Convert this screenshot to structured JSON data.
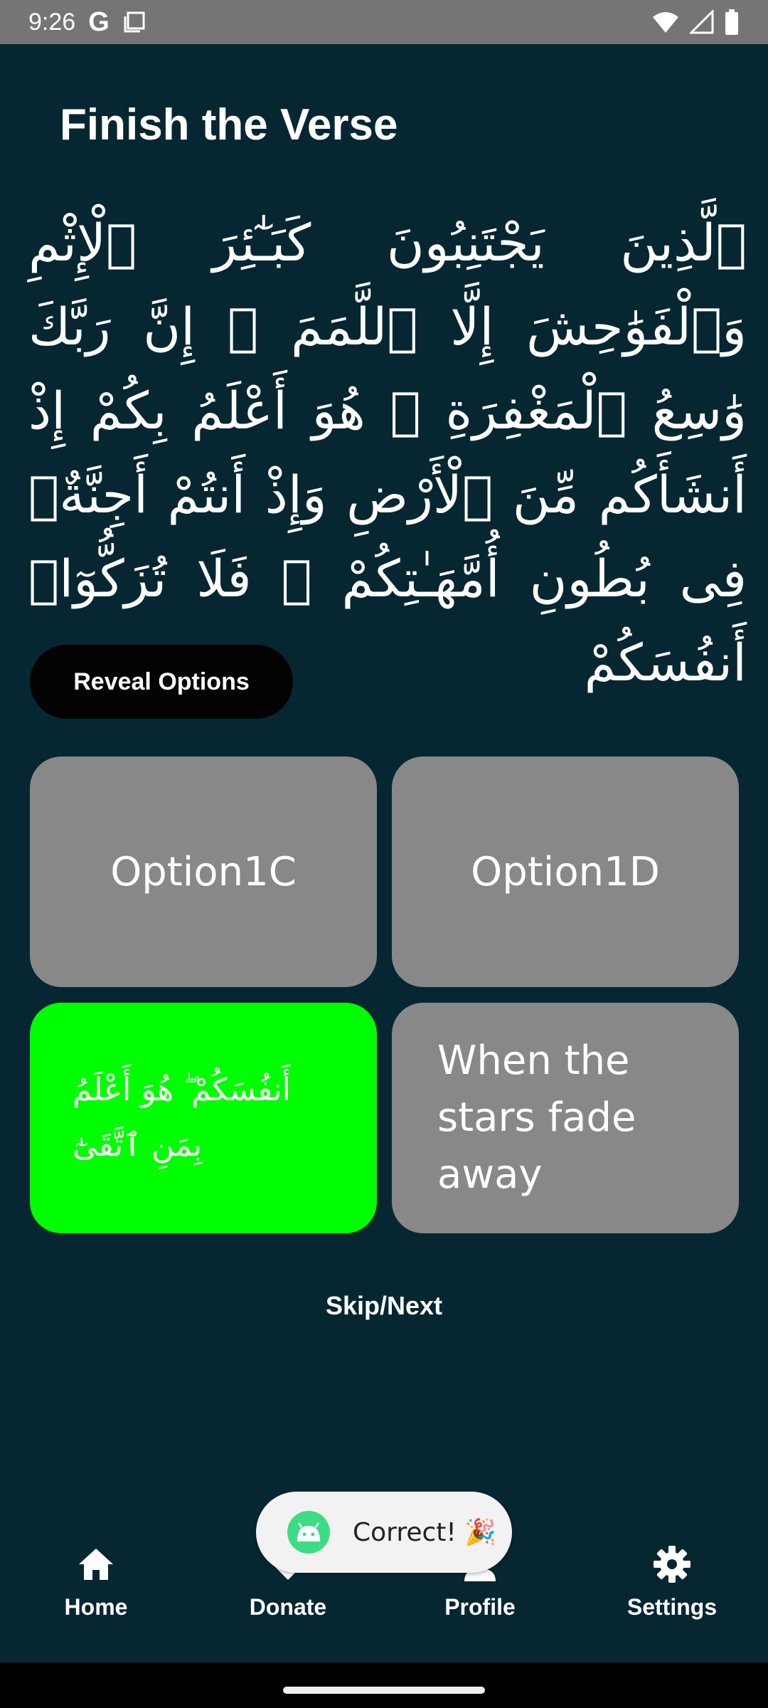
{
  "status_bar": {
    "time": "9:26",
    "g_label": "G"
  },
  "title": "Finish the Verse",
  "verse": "ٱلَّذِينَ يَجْتَنِبُونَ كَبَـٰٓئِرَ ٱلْإِثْمِ وَٱلْفَوَٰحِشَ إِلَّا ٱللَّمَمَ ۚ إِنَّ رَبَّكَ وَٰسِعُ ٱلْمَغْفِرَةِ ۚ هُوَ أَعْلَمُ بِكُمْ إِذْ أَنشَأَكُم مِّنَ ٱلْأَرْضِ وَإِذْ أَنتُمْ أَجِنَّةٌۭ فِى بُطُونِ أُمَّهَـٰتِكُمْ ۖ فَلَا تُزَكُّوٓا۟ أَنفُسَكُمْ",
  "reveal_button": "Reveal Options",
  "options": [
    {
      "label": "Option1C"
    },
    {
      "label": "Option1D"
    },
    {
      "label": "أَنفُسَكُمْ ۖ هُوَ أَعْلَمُ بِمَنِ ٱتَّقَىٰٓ",
      "state": "correct",
      "color": "#00ff00"
    },
    {
      "label": "When the stars fade away"
    }
  ],
  "skip_label": "Skip/Next",
  "toast": {
    "text": "Correct! 🎉"
  },
  "nav": [
    {
      "label": "Home",
      "icon": "home-icon"
    },
    {
      "label": "Donate",
      "icon": "donate-icon"
    },
    {
      "label": "Profile",
      "icon": "profile-icon"
    },
    {
      "label": "Settings",
      "icon": "gear-icon"
    }
  ],
  "colors": {
    "background": "#062731",
    "option_bg": "#888888",
    "correct": "#00ff00",
    "status_bar": "#757575"
  }
}
